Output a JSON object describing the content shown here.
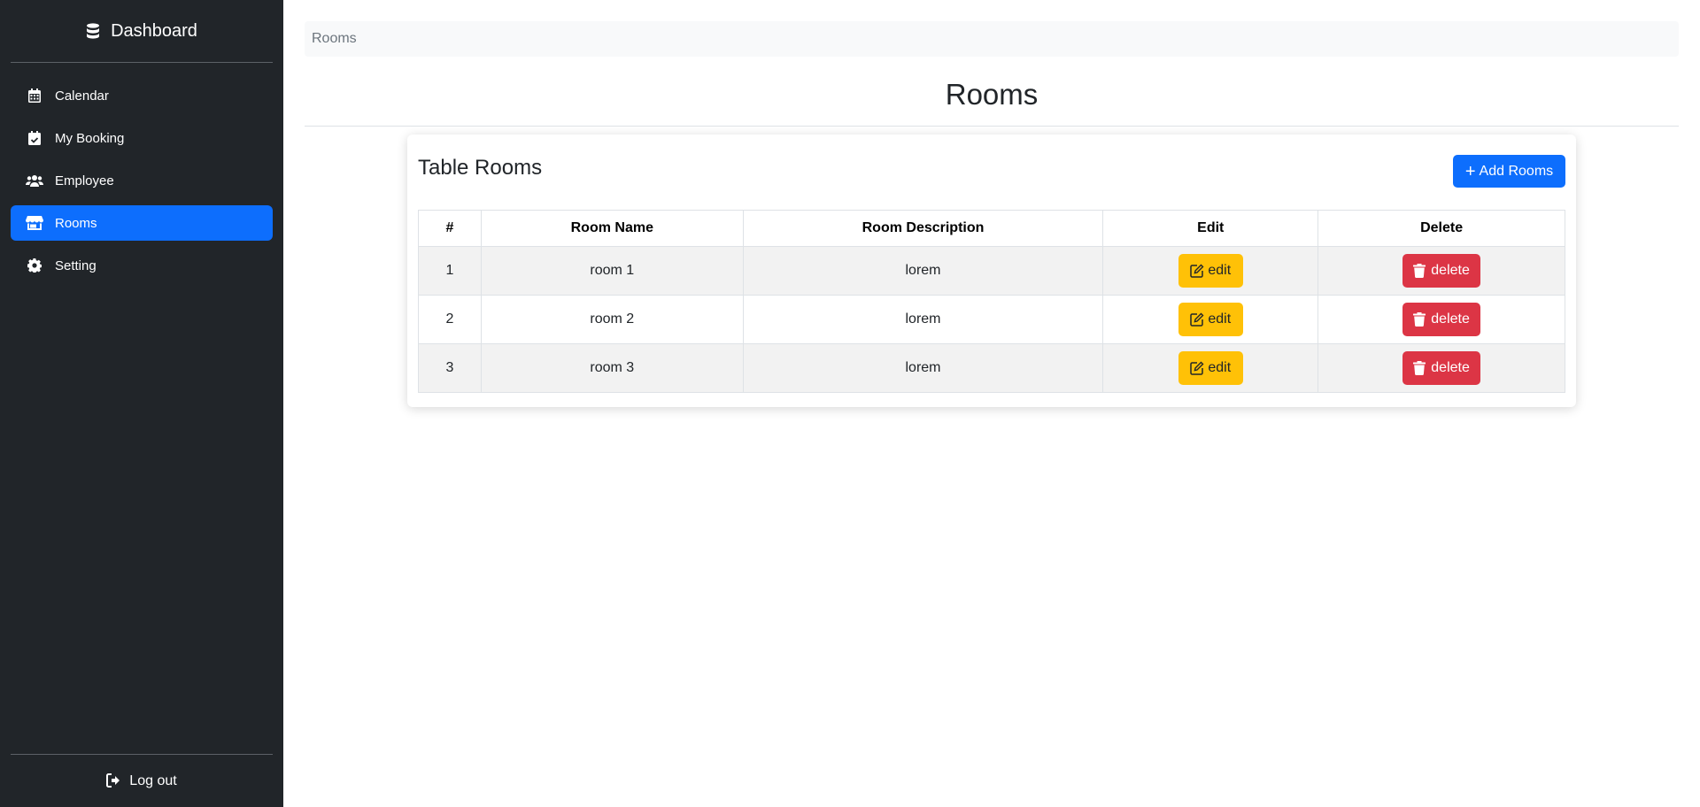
{
  "sidebar": {
    "brand": "Dashboard",
    "brand_icon": "database-icon",
    "items": [
      {
        "label": "Calendar",
        "icon": "calendar-icon"
      },
      {
        "label": "My Booking",
        "icon": "calendar-check-icon"
      },
      {
        "label": "Employee",
        "icon": "users-icon"
      },
      {
        "label": "Rooms",
        "icon": "store-icon",
        "active": true
      },
      {
        "label": "Setting",
        "icon": "gear-icon"
      }
    ],
    "logout": "Log out",
    "logout_icon": "sign-out-icon"
  },
  "breadcrumb": "Rooms",
  "page_title": "Rooms",
  "card": {
    "title": "Table Rooms",
    "add_button": "Add Rooms"
  },
  "table": {
    "headers": [
      "#",
      "Room Name",
      "Room Description",
      "Edit",
      "Delete"
    ],
    "rows": [
      {
        "num": "1",
        "name": "room 1",
        "description": "lorem",
        "edit": "edit",
        "delete": "delete"
      },
      {
        "num": "2",
        "name": "room 2",
        "description": "lorem",
        "edit": "edit",
        "delete": "delete"
      },
      {
        "num": "3",
        "name": "room 3",
        "description": "lorem",
        "edit": "edit",
        "delete": "delete"
      }
    ]
  },
  "colors": {
    "sidebar_bg": "#212529",
    "primary": "#0d6efd",
    "warning": "#ffc107",
    "danger": "#dc3545"
  }
}
